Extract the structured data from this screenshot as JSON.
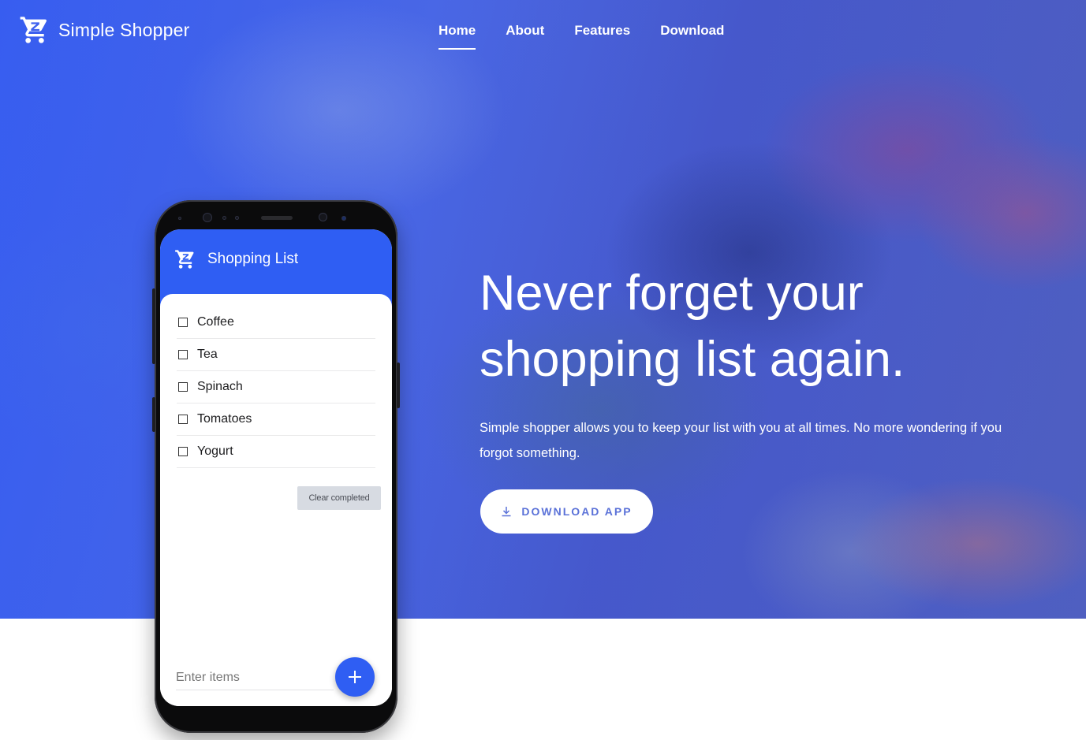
{
  "brand": {
    "name": "Simple Shopper",
    "icon": "shopping-cart-icon"
  },
  "nav": {
    "items": [
      {
        "label": "Home",
        "active": true
      },
      {
        "label": "About",
        "active": false
      },
      {
        "label": "Features",
        "active": false
      },
      {
        "label": "Download",
        "active": false
      }
    ]
  },
  "hero": {
    "headline_line1": "Never forget your",
    "headline_line2": "shopping list again.",
    "description": "Simple shopper allows you to keep your list with you at all times. No more wondering if you forgot something.",
    "cta_label": "DOWNLOAD APP",
    "cta_icon": "download-icon"
  },
  "phone": {
    "app_title": "Shopping List",
    "items": [
      "Coffee",
      "Tea",
      "Spinach",
      "Tomatoes",
      "Yogurt"
    ],
    "clear_label": "Clear completed",
    "input_placeholder": "Enter items",
    "fab_icon": "plus-icon"
  },
  "colors": {
    "accent": "#2f5ef3",
    "cta_text": "#5b72d8",
    "hero_tint": "#4a66e6"
  }
}
